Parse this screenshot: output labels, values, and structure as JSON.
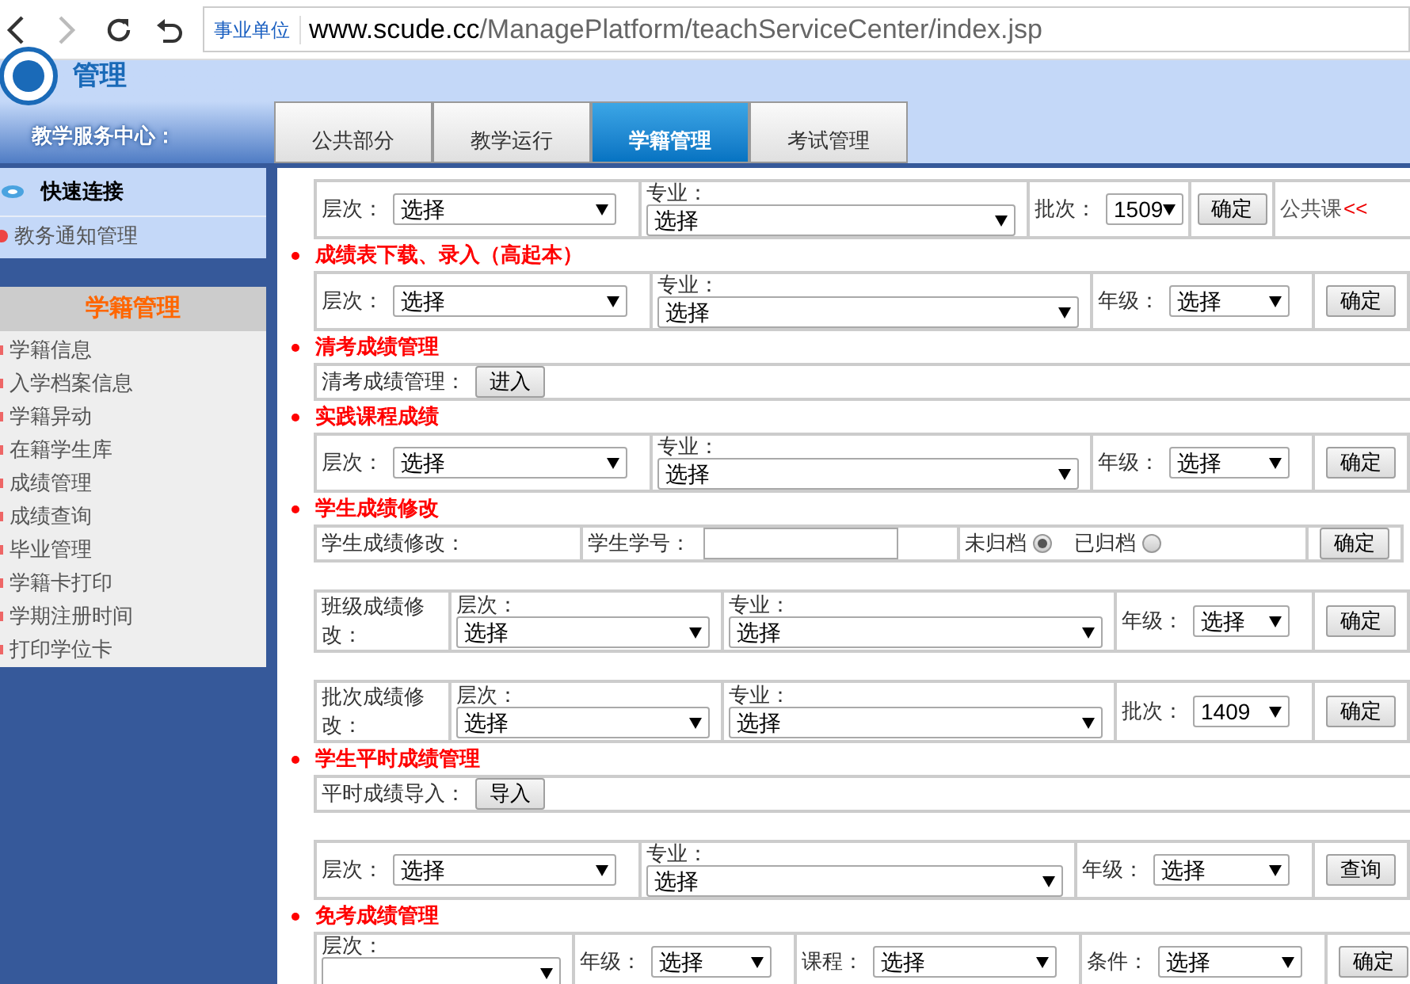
{
  "browser": {
    "site_tag": "事业单位",
    "url_host": "www.scude.cc",
    "url_path": "/ManagePlatform/teachServiceCenter/index.jsp"
  },
  "header": {
    "logo_text": "管理",
    "center_label": "教学服务中心："
  },
  "tabs": [
    {
      "label": "公共部分",
      "selected": false
    },
    {
      "label": "教学运行",
      "selected": false
    },
    {
      "label": "学籍管理",
      "selected": true
    },
    {
      "label": "考试管理",
      "selected": false
    }
  ],
  "quick_links": {
    "title": "快速连接",
    "items": [
      "教务通知管理"
    ]
  },
  "menu": {
    "title": "学籍管理",
    "items": [
      "学籍信息",
      "入学档案信息",
      "学籍异动",
      "在籍学生库",
      "成绩管理",
      "成绩查询",
      "毕业管理",
      "学籍卡打印",
      "学期注册时间",
      "打印学位卡"
    ]
  },
  "sections": [
    {
      "forms": [
        {
          "fields": [
            {
              "kind": "select",
              "label": "层次：",
              "value": "选择"
            },
            {
              "kind": "select_stacked",
              "label": "专业：",
              "value": "选择"
            },
            {
              "kind": "select",
              "label": "批次：",
              "value": "1509"
            },
            {
              "kind": "button",
              "label": "确定"
            },
            {
              "kind": "link_text",
              "text": "公共课",
              "link": "<<"
            }
          ]
        }
      ]
    },
    {
      "title": "成绩表下载、录入（高起本）",
      "forms": [
        {
          "fields": [
            {
              "kind": "select",
              "label": "层次：",
              "value": "选择"
            },
            {
              "kind": "select_stacked",
              "label": "专业：",
              "value": "选择"
            },
            {
              "kind": "select",
              "label": "年级：",
              "value": "选择"
            },
            {
              "kind": "button",
              "label": "确定"
            }
          ]
        }
      ]
    },
    {
      "title": "清考成绩管理",
      "forms": [
        {
          "fields": [
            {
              "kind": "action",
              "label": "清考成绩管理：",
              "button": "进入"
            }
          ]
        }
      ]
    },
    {
      "title": "实践课程成绩",
      "forms": [
        {
          "fields": [
            {
              "kind": "select",
              "label": "层次：",
              "value": "选择"
            },
            {
              "kind": "select_stacked",
              "label": "专业：",
              "value": "选择"
            },
            {
              "kind": "select",
              "label": "年级：",
              "value": "选择"
            },
            {
              "kind": "button",
              "label": "确定"
            }
          ]
        }
      ]
    },
    {
      "title": "学生成绩修改",
      "forms": [
        {
          "fields": [
            {
              "kind": "text",
              "text": "学生成绩修改："
            },
            {
              "kind": "input",
              "label": "学生学号："
            },
            {
              "kind": "radios",
              "options": [
                {
                  "label": "未归档",
                  "selected": true
                },
                {
                  "label": "已归档",
                  "selected": false
                }
              ]
            },
            {
              "kind": "button",
              "label": "确定"
            }
          ]
        },
        {
          "fields": [
            {
              "kind": "text",
              "text": "班级成绩修改："
            },
            {
              "kind": "select_stacked",
              "label": "层次：",
              "value": "选择"
            },
            {
              "kind": "select_stacked",
              "label": "专业：",
              "value": "选择"
            },
            {
              "kind": "select",
              "label": "年级：",
              "value": "选择"
            },
            {
              "kind": "button",
              "label": "确定"
            }
          ]
        },
        {
          "fields": [
            {
              "kind": "text",
              "text": "批次成绩修改："
            },
            {
              "kind": "select_stacked",
              "label": "层次：",
              "value": "选择"
            },
            {
              "kind": "select_stacked",
              "label": "专业：",
              "value": "选择"
            },
            {
              "kind": "select",
              "label": "批次：",
              "value": "1409"
            },
            {
              "kind": "button",
              "label": "确定"
            }
          ]
        }
      ]
    },
    {
      "title": "学生平时成绩管理",
      "forms": [
        {
          "fields": [
            {
              "kind": "action",
              "label": "平时成绩导入：",
              "button": "导入"
            }
          ]
        },
        {
          "fields": [
            {
              "kind": "select",
              "label": "层次：",
              "value": "选择"
            },
            {
              "kind": "select_stacked",
              "label": "专业：",
              "value": "选择"
            },
            {
              "kind": "select",
              "label": "年级：",
              "value": "选择"
            },
            {
              "kind": "button",
              "label": "查询"
            }
          ]
        }
      ]
    },
    {
      "title": "免考成绩管理",
      "forms": [
        {
          "fields": [
            {
              "kind": "select_stacked",
              "label": "层次："
            },
            {
              "kind": "select",
              "label": "年级：",
              "value": "选择"
            },
            {
              "kind": "select",
              "label": "课程：",
              "value": "选择"
            },
            {
              "kind": "select",
              "label": "条件：",
              "value": "选择"
            },
            {
              "kind": "button",
              "label": "确定"
            }
          ]
        }
      ]
    }
  ]
}
